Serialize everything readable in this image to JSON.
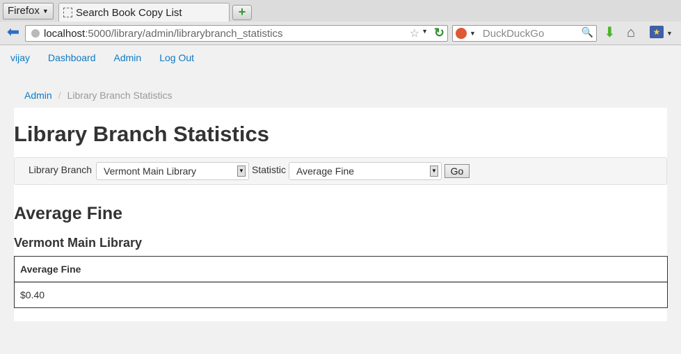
{
  "browser": {
    "menu_label": "Firefox",
    "tab_title": "Search Book Copy List",
    "new_tab_label": "+",
    "url_host": "localhost",
    "url_path": ":5000/library/admin/librarybranch_statistics",
    "search_placeholder": "DuckDuckGo"
  },
  "topnav": {
    "items": [
      "vijay",
      "Dashboard",
      "Admin",
      "Log Out"
    ]
  },
  "breadcrumb": {
    "link": "Admin",
    "separator": "/",
    "current": "Library Branch Statistics"
  },
  "main": {
    "title": "Library Branch Statistics",
    "form": {
      "branch_label": "Library Branch",
      "branch_value": "Vermont Main Library",
      "statistic_label": "Statistic",
      "statistic_value": "Average Fine",
      "go_label": "Go"
    },
    "section_title": "Average Fine",
    "sub_title": "Vermont Main Library",
    "table": {
      "header": "Average Fine",
      "value": "$0.40"
    }
  },
  "icons": {
    "accent_link": "#0d7ac3",
    "download_color": "#4ab52a"
  }
}
